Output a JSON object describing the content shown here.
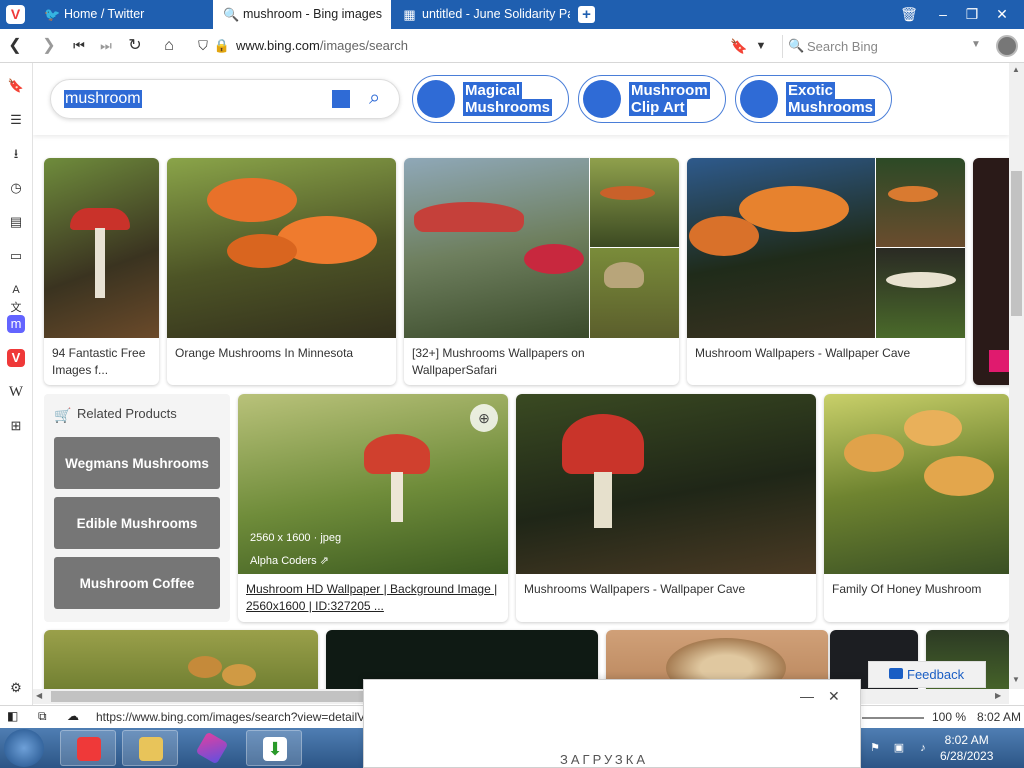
{
  "browser": {
    "tabs": [
      {
        "label": "Home / Twitter",
        "icon": "twitter-icon"
      },
      {
        "label": "mushroom - Bing images",
        "icon": "search-icon"
      },
      {
        "label": "untitled - June Solidarity Pa",
        "icon": "image-icon"
      }
    ],
    "url_host": "www.bing.com",
    "url_path": "/images/search",
    "search_placeholder": "Search Bing"
  },
  "search": {
    "query": "mushroom",
    "pills": [
      {
        "line1": "Magical",
        "line2": "Mushrooms"
      },
      {
        "line1": "Mushroom",
        "line2": "Clip Art"
      },
      {
        "line1": "Exotic",
        "line2": "Mushrooms"
      }
    ]
  },
  "results_row1": [
    {
      "caption1": "94 Fantastic Free",
      "caption2": "Images f..."
    },
    {
      "caption1": "Orange Mushrooms In Minnesota",
      "caption2": ""
    },
    {
      "caption1": "[32+] Mushrooms Wallpapers on",
      "caption2": "WallpaperSafari"
    },
    {
      "caption1": "Mushroom Wallpapers - Wallpaper Cave",
      "caption2": ""
    }
  ],
  "related": {
    "heading": "Related Products",
    "items": [
      "Wegmans Mushrooms",
      "Edible Mushrooms",
      "Mushroom Coffee"
    ]
  },
  "results_row2": [
    {
      "caption1": "Mushroom HD Wallpaper | Background Image |",
      "caption2": "2560x1600 | ID:327205 ...",
      "size": "2560 x 1600 · jpeg",
      "source": "Alpha Coders"
    },
    {
      "caption1": "Mushrooms Wallpapers - Wallpaper Cave",
      "caption2": ""
    },
    {
      "caption1": "Family Of Honey Mushroom",
      "caption2": ""
    }
  ],
  "feedback_label": "Feedback",
  "status": {
    "url_preview": "https://www.bing.com/images/search?view=detailV2",
    "zoom": "100 %",
    "time": "8:02 AM"
  },
  "taskbar": {
    "time": "8:02 AM",
    "date": "6/28/2023"
  },
  "popup": {
    "title": "ЗАГРУЗКА"
  }
}
